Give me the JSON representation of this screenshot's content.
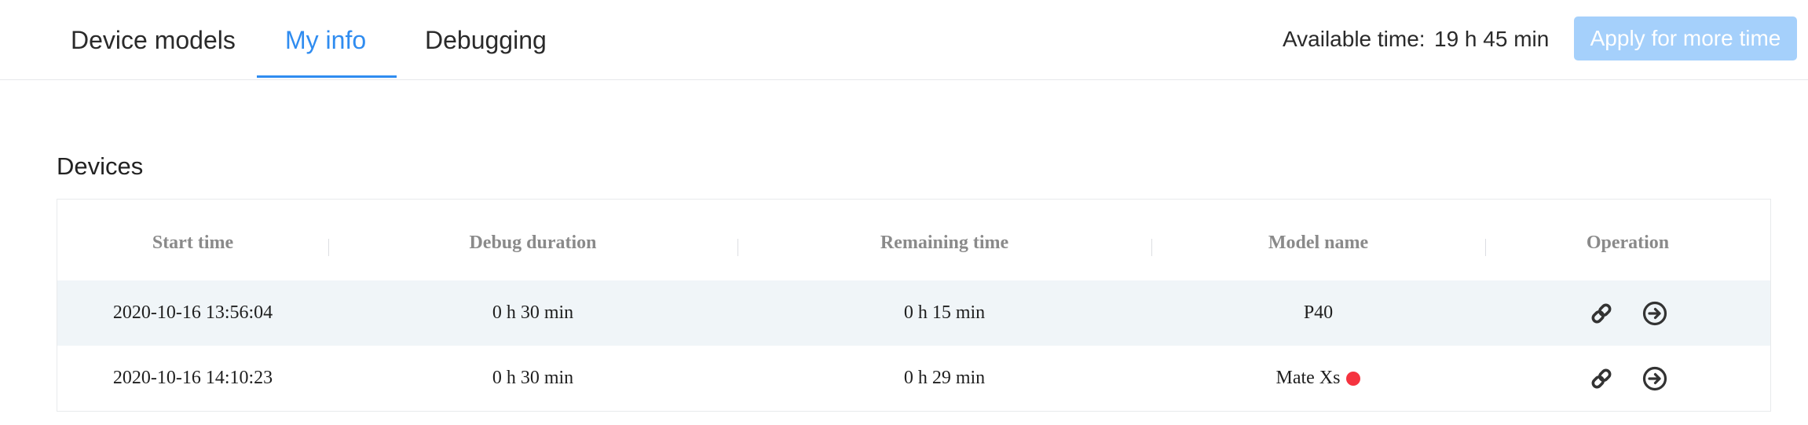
{
  "tabs": [
    {
      "label": "Device models",
      "active": false
    },
    {
      "label": "My info",
      "active": true
    },
    {
      "label": "Debugging",
      "active": false
    }
  ],
  "available": {
    "label": "Available time:",
    "value": "19 h 45 min"
  },
  "apply_button": {
    "label": "Apply for more time",
    "disabled": true
  },
  "devices": {
    "title": "Devices",
    "columns": [
      "Start time",
      "Debug duration",
      "Remaining time",
      "Model name",
      "Operation"
    ],
    "rows": [
      {
        "start_time": "2020-10-16 13:56:04",
        "debug_duration": "0 h 30 min",
        "remaining_time": "0 h 15 min",
        "model_name": "P40",
        "status_dot": false,
        "operations": [
          "link-icon",
          "arrow-right-circle-icon"
        ]
      },
      {
        "start_time": "2020-10-16 14:10:23",
        "debug_duration": "0 h 30 min",
        "remaining_time": "0 h 29 min",
        "model_name": "Mate Xs",
        "status_dot": true,
        "operations": [
          "link-icon",
          "arrow-right-circle-icon"
        ]
      }
    ]
  },
  "colors": {
    "accent": "#2f8cf0",
    "button_disabled": "#a5d0fb",
    "row_highlight": "#f0f5f8",
    "status_dot": "#f5333f"
  }
}
